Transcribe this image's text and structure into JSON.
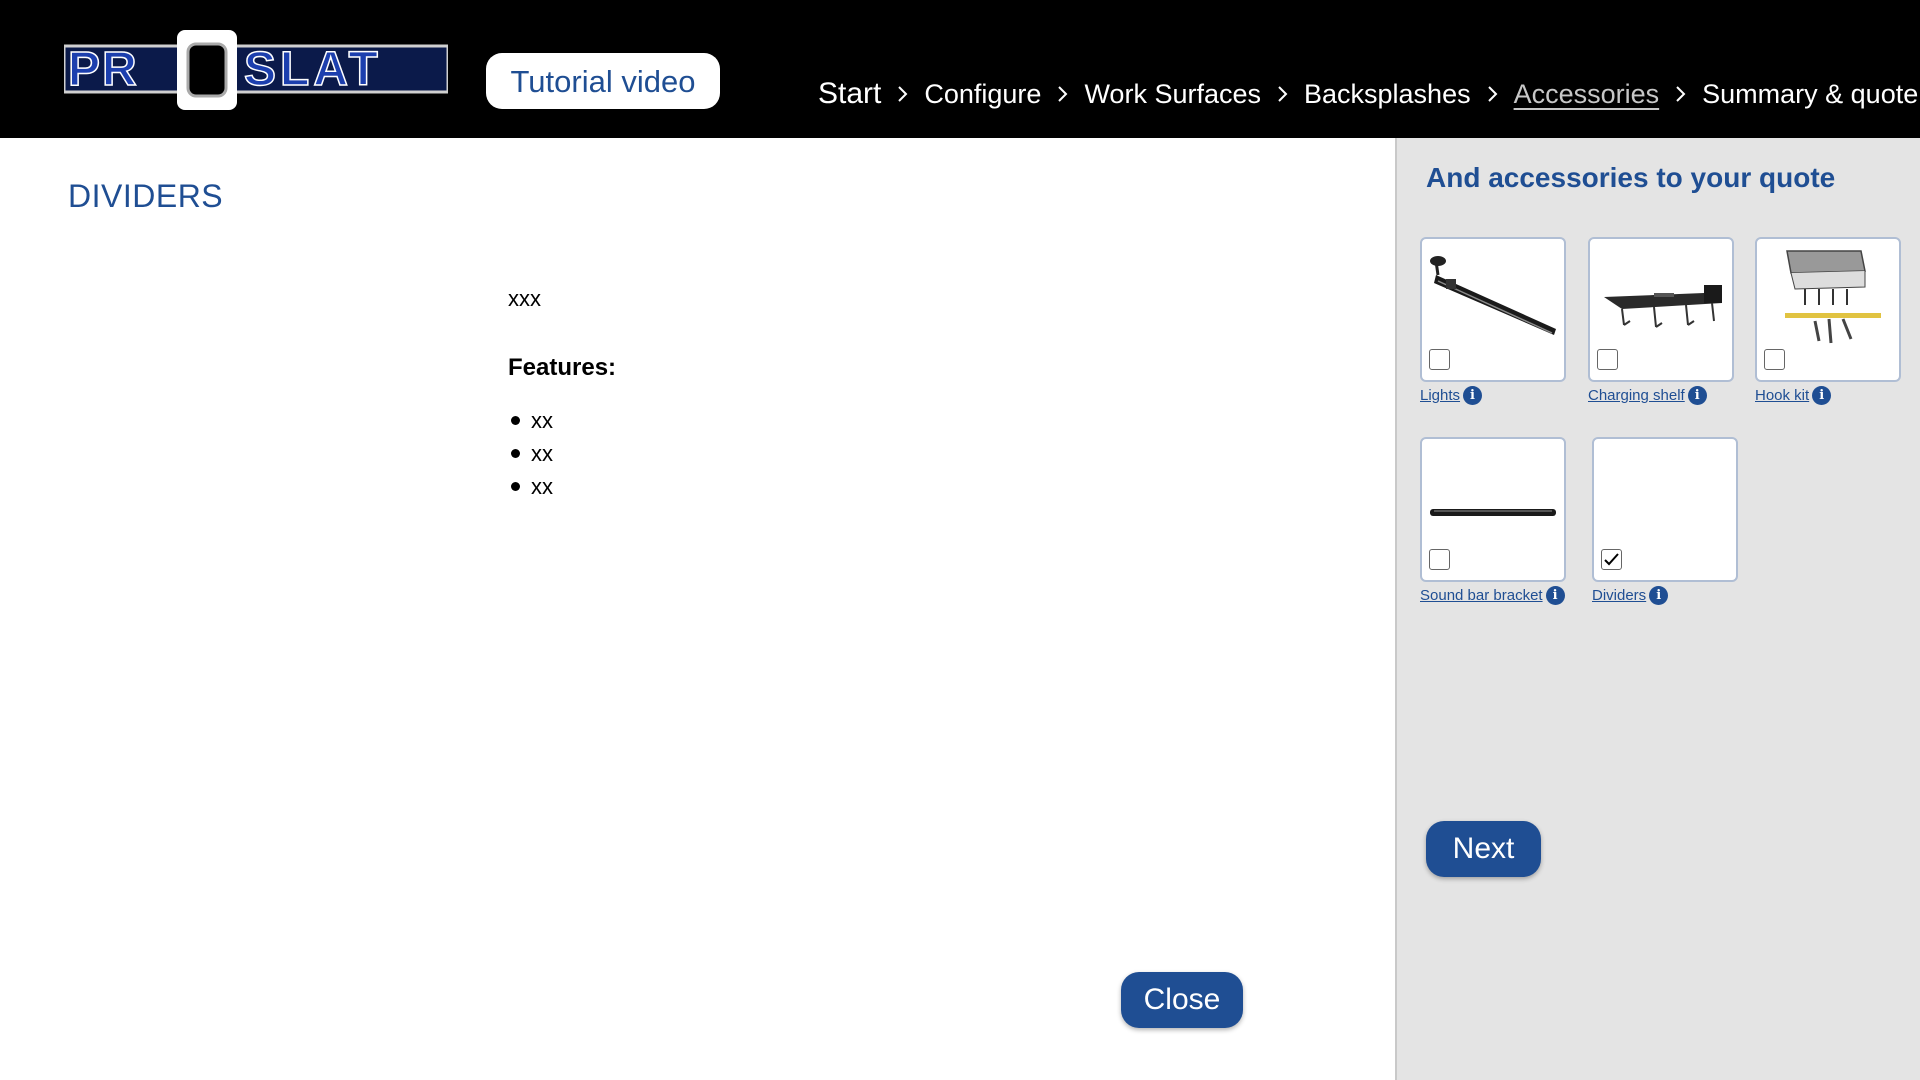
{
  "header": {
    "logo_text": "PROSLAT",
    "tutorial_label": "Tutorial video",
    "breadcrumbs": [
      {
        "label": "Start"
      },
      {
        "label": "Configure"
      },
      {
        "label": "Work Surfaces"
      },
      {
        "label": "Backsplashes"
      },
      {
        "label": "Accessories",
        "current": true
      },
      {
        "label": "Summary & quote"
      }
    ]
  },
  "main": {
    "title": "DIVIDERS",
    "description": "xxx",
    "features_label": "Features:",
    "features": [
      "xx",
      "xx",
      "xx"
    ],
    "close_label": "Close"
  },
  "sidebar": {
    "title": "And accessories to your quote",
    "items": [
      {
        "label": "Lights",
        "checked": false,
        "icon": "lights-image"
      },
      {
        "label": "Charging shelf",
        "checked": false,
        "icon": "charging-shelf-image"
      },
      {
        "label": "Hook kit",
        "checked": false,
        "icon": "hook-kit-image"
      },
      {
        "label": "Sound bar bracket ",
        "checked": false,
        "icon": "sound-bar-bracket-image"
      },
      {
        "label": "Dividers",
        "checked": true,
        "icon": "dividers-image"
      }
    ],
    "next_label": "Next"
  },
  "colors": {
    "brand_blue": "#1f4e93",
    "header_bg": "#000000",
    "sidebar_bg": "#e4e4e4"
  }
}
